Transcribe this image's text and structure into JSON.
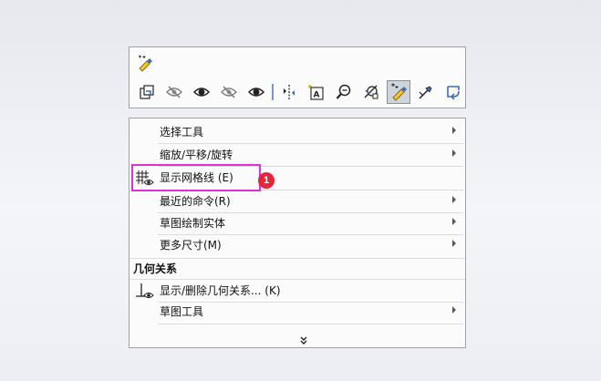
{
  "colors": {
    "highlight": "#e22fd8",
    "badge": "#e8243a"
  },
  "toolbar": {
    "top_icon": "sketch-entity-pin-icon",
    "buttons": [
      {
        "icon": "view-orientation-icon",
        "active": false
      },
      {
        "icon": "hide-icon",
        "active": false
      },
      {
        "icon": "show-icon",
        "active": false
      },
      {
        "icon": "hide-alt-icon",
        "active": false
      },
      {
        "icon": "show-alt-icon",
        "active": false
      },
      {
        "icon": "mirror-entities-icon",
        "active": false
      },
      {
        "icon": "smart-dimension-note-icon",
        "active": false
      },
      {
        "icon": "zoom-selection-icon",
        "active": false
      },
      {
        "icon": "sketch-relations-icon",
        "active": false
      },
      {
        "icon": "display-grid-icon",
        "active": true
      },
      {
        "icon": "pencil-constraint-icon",
        "active": false
      },
      {
        "icon": "exit-sketch-icon",
        "active": false
      }
    ]
  },
  "menu": {
    "items": [
      {
        "label": "选择工具",
        "has_submenu": true
      },
      {
        "label": "缩放/平移/旋转",
        "has_submenu": true
      },
      {
        "label": "显示网格线 (E)",
        "has_submenu": false,
        "icon": "grid-eye-icon"
      },
      {
        "label": "最近的命令(R)",
        "has_submenu": true
      },
      {
        "label": "草图绘制实体",
        "has_submenu": true
      },
      {
        "label": "更多尺寸(M)",
        "has_submenu": true
      }
    ],
    "section_title": "几何关系",
    "section_items": [
      {
        "label": "显示/删除几何关系... (K)",
        "has_submenu": false,
        "icon": "relation-eye-icon"
      },
      {
        "label": "草图工具",
        "has_submenu": true
      }
    ],
    "more_icon": "double-chevron-down-icon"
  },
  "callout": {
    "number": "1"
  }
}
